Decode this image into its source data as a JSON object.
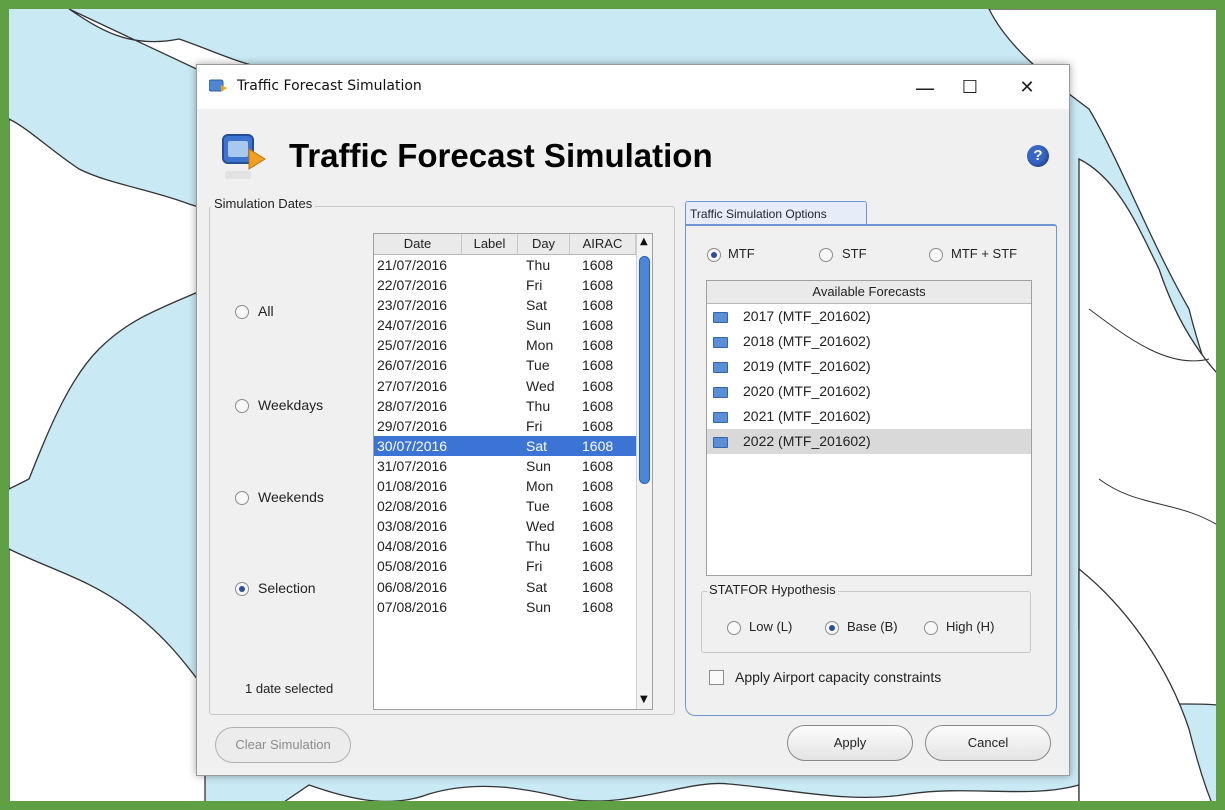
{
  "window": {
    "title": "Traffic Forecast Simulation",
    "controls": {
      "minimize": "—",
      "maximize": "☐",
      "close": "✕"
    }
  },
  "header": {
    "title": "Traffic Forecast Simulation",
    "help": "?"
  },
  "simulation_dates": {
    "group_label": "Simulation Dates",
    "options": [
      {
        "label": "All",
        "selected": false
      },
      {
        "label": "Weekdays",
        "selected": false
      },
      {
        "label": "Weekends",
        "selected": false
      },
      {
        "label": "Selection",
        "selected": true
      }
    ],
    "selected_count": "1 date selected",
    "columns": [
      "Date",
      "Label",
      "Day",
      "AIRAC"
    ],
    "rows": [
      {
        "date": "21/07/2016",
        "label": "",
        "day": "Thu",
        "airac": "1608"
      },
      {
        "date": "22/07/2016",
        "label": "",
        "day": "Fri",
        "airac": "1608"
      },
      {
        "date": "23/07/2016",
        "label": "",
        "day": "Sat",
        "airac": "1608"
      },
      {
        "date": "24/07/2016",
        "label": "",
        "day": "Sun",
        "airac": "1608"
      },
      {
        "date": "25/07/2016",
        "label": "",
        "day": "Mon",
        "airac": "1608"
      },
      {
        "date": "26/07/2016",
        "label": "",
        "day": "Tue",
        "airac": "1608"
      },
      {
        "date": "27/07/2016",
        "label": "",
        "day": "Wed",
        "airac": "1608"
      },
      {
        "date": "28/07/2016",
        "label": "",
        "day": "Thu",
        "airac": "1608"
      },
      {
        "date": "29/07/2016",
        "label": "",
        "day": "Fri",
        "airac": "1608"
      },
      {
        "date": "30/07/2016",
        "label": "",
        "day": "Sat",
        "airac": "1608",
        "selected": true
      },
      {
        "date": "31/07/2016",
        "label": "",
        "day": "Sun",
        "airac": "1608"
      },
      {
        "date": "01/08/2016",
        "label": "",
        "day": "Mon",
        "airac": "1608"
      },
      {
        "date": "02/08/2016",
        "label": "",
        "day": "Tue",
        "airac": "1608"
      },
      {
        "date": "03/08/2016",
        "label": "",
        "day": "Wed",
        "airac": "1608"
      },
      {
        "date": "04/08/2016",
        "label": "",
        "day": "Thu",
        "airac": "1608"
      },
      {
        "date": "05/08/2016",
        "label": "",
        "day": "Fri",
        "airac": "1608"
      },
      {
        "date": "06/08/2016",
        "label": "",
        "day": "Sat",
        "airac": "1608"
      },
      {
        "date": "07/08/2016",
        "label": "",
        "day": "Sun",
        "airac": "1608"
      }
    ]
  },
  "traffic_options": {
    "tab_label": "Traffic Simulation Options",
    "modes": [
      {
        "label": "MTF",
        "selected": true
      },
      {
        "label": "STF",
        "selected": false
      },
      {
        "label": "MTF + STF",
        "selected": false
      }
    ],
    "forecasts_header": "Available Forecasts",
    "forecasts": [
      {
        "label": "2017 (MTF_201602)",
        "selected": false
      },
      {
        "label": "2018 (MTF_201602)",
        "selected": false
      },
      {
        "label": "2019 (MTF_201602)",
        "selected": false
      },
      {
        "label": "2020 (MTF_201602)",
        "selected": false
      },
      {
        "label": "2021 (MTF_201602)",
        "selected": false
      },
      {
        "label": "2022 (MTF_201602)",
        "selected": true
      }
    ],
    "hypothesis_label": "STATFOR Hypothesis",
    "hypotheses": [
      {
        "label": "Low (L)",
        "selected": false
      },
      {
        "label": "Base (B)",
        "selected": true
      },
      {
        "label": "High (H)",
        "selected": false
      }
    ],
    "capacity_label": "Apply Airport capacity constraints",
    "capacity_checked": false
  },
  "buttons": {
    "clear": "Clear Simulation",
    "apply": "Apply",
    "cancel": "Cancel"
  },
  "colors": {
    "frame_border": "#5fa044",
    "sea": "#c9eaf5",
    "land": "#ffffff",
    "selection": "#3c74d6",
    "tab_border": "#6d97d4"
  }
}
